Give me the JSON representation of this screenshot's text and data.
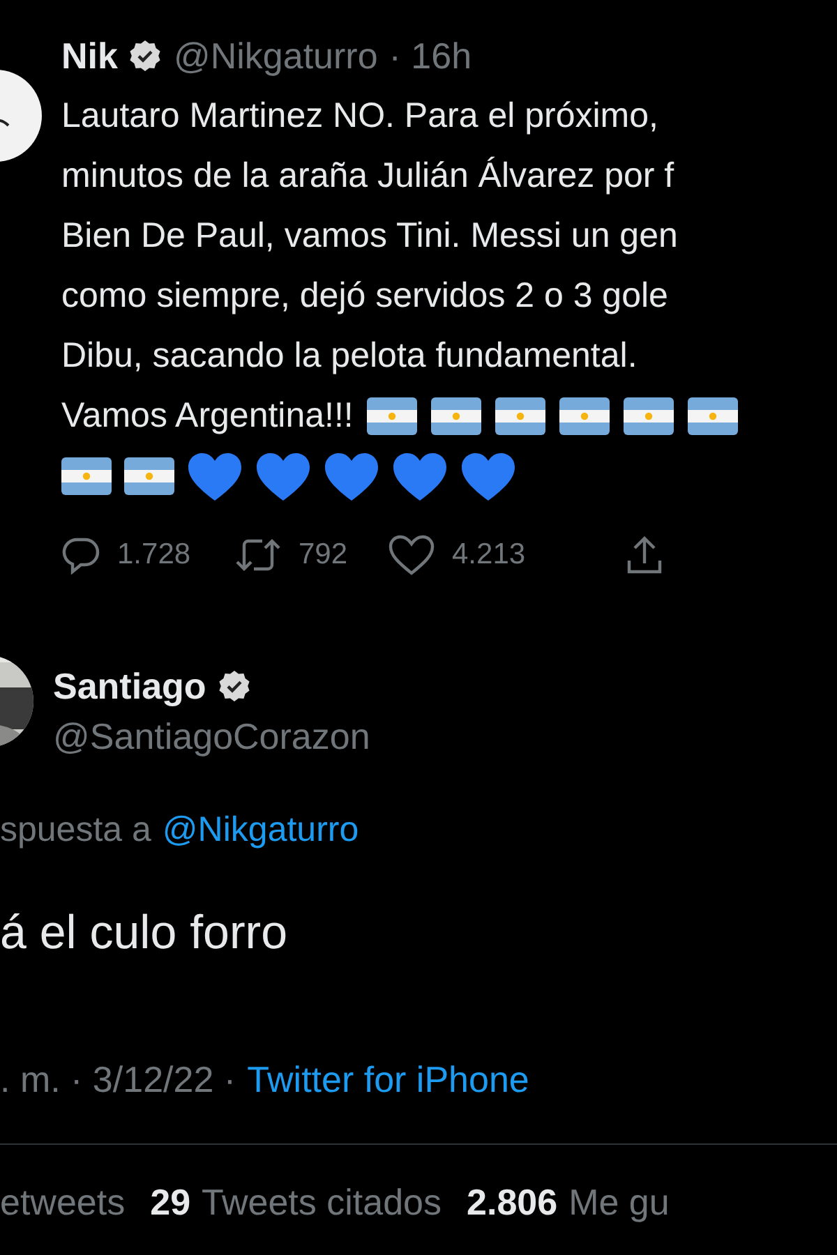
{
  "tweet": {
    "author": {
      "name": "Nik",
      "verified": true,
      "handle": "@Nikgaturro",
      "time": "· 16h"
    },
    "text": "Lautaro Martinez NO. Para el próximo,\nminutos de la araña Julián Álvarez por f\nBien De Paul, vamos Tini. Messi un gen\ncomo siempre, dejó servidos 2 o 3 gole\nDibu, sacando la pelota fundamental.",
    "closing": "Vamos Argentina!!!",
    "emojis": [
      {
        "kind": "flag"
      },
      {
        "kind": "flag"
      },
      {
        "kind": "flag"
      },
      {
        "kind": "flag"
      },
      {
        "kind": "flag"
      },
      {
        "kind": "flag"
      },
      {
        "kind": "flag"
      },
      {
        "kind": "flag"
      },
      {
        "kind": "heart"
      },
      {
        "kind": "heart"
      },
      {
        "kind": "heart"
      },
      {
        "kind": "heart"
      },
      {
        "kind": "heart"
      }
    ],
    "actions": [
      {
        "kind": "reply",
        "count": "1.728"
      },
      {
        "kind": "retweet",
        "count": "792"
      },
      {
        "kind": "like",
        "count": "4.213"
      },
      {
        "kind": "share"
      }
    ]
  },
  "reply": {
    "author": {
      "name": "Santiago",
      "verified": true,
      "handle": "@SantiagoCorazon"
    },
    "replying_to": {
      "prefix": "spuesta a",
      "mention": "@Nikgaturro"
    },
    "text": "á el culo forro",
    "meta": ". m. · 3/12/22 ·",
    "source": "Twitter for iPhone",
    "stats": [
      {
        "label": "etweets"
      },
      {
        "count": "29",
        "label": "Tweets citados"
      },
      {
        "count": "2.806",
        "label": "Me gu"
      }
    ]
  }
}
